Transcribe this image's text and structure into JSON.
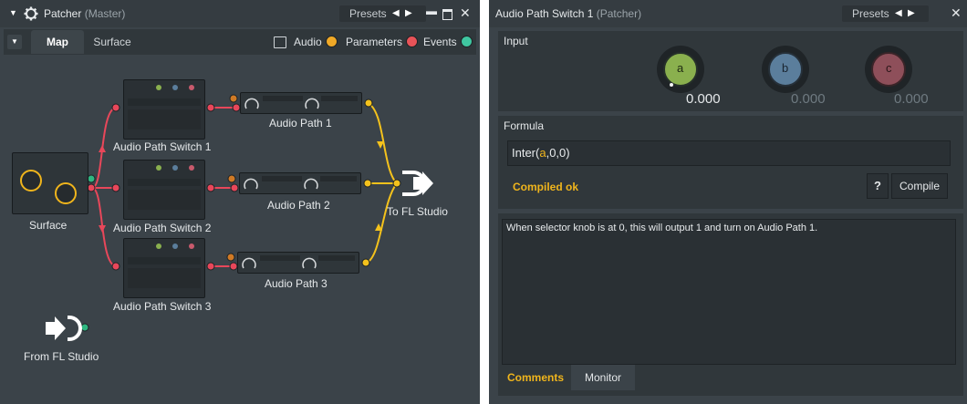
{
  "patcher": {
    "title": "Patcher",
    "subtitle": "(Master)",
    "presets_label": "Presets",
    "tabs": [
      "Map",
      "Surface"
    ],
    "legend": [
      {
        "label": "Audio",
        "color": "#f0a927"
      },
      {
        "label": "Parameters",
        "color": "#e85358"
      },
      {
        "label": "Events",
        "color": "#3fc6a0"
      }
    ],
    "nodes": {
      "surface": "Surface",
      "switch1": "Audio Path Switch 1",
      "switch2": "Audio Path Switch 2",
      "switch3": "Audio Path Switch 3",
      "path1": "Audio Path 1",
      "path2": "Audio Path 2",
      "path3": "Audio Path 3",
      "to_fl": "To FL Studio",
      "from_fl": "From FL Studio"
    }
  },
  "switch_window": {
    "title": "Audio Path Switch 1",
    "subtitle": "(Patcher)",
    "presets_label": "Presets",
    "input_label": "Input",
    "knobs": [
      {
        "label": "a",
        "value": "0.000",
        "color": "#8ab04e"
      },
      {
        "label": "b",
        "value": "0.000",
        "color": "#5b7e9c"
      },
      {
        "label": "c",
        "value": "0.000",
        "color": "#8e4f5a"
      }
    ],
    "formula_label": "Formula",
    "formula": {
      "prefix": "Inter(",
      "var": "a",
      "suffix": ",0,0)"
    },
    "status": "Compiled ok",
    "help_label": "?",
    "compile_label": "Compile",
    "comment": "When selector knob is at 0, this will output 1 and turn on Audio Path 1.",
    "bottom_tabs": [
      "Comments",
      "Monitor"
    ]
  }
}
